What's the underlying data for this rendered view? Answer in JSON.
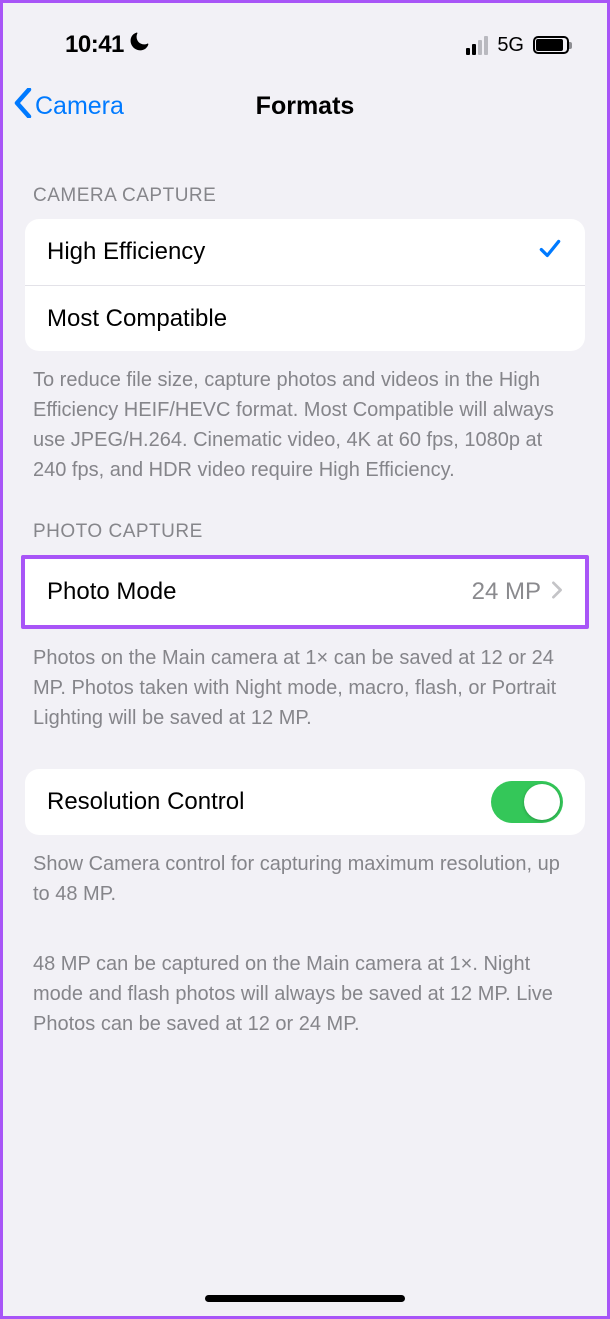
{
  "status": {
    "time": "10:41",
    "network": "5G"
  },
  "nav": {
    "back_label": "Camera",
    "title": "Formats"
  },
  "sections": {
    "camera_capture": {
      "header": "CAMERA CAPTURE",
      "options": [
        {
          "label": "High Efficiency",
          "selected": true
        },
        {
          "label": "Most Compatible",
          "selected": false
        }
      ],
      "footer": "To reduce file size, capture photos and videos in the High Efficiency HEIF/HEVC format. Most Compatible will always use JPEG/H.264. Cinematic video, 4K at 60 fps, 1080p at 240 fps, and HDR video require High Efficiency."
    },
    "photo_capture": {
      "header": "PHOTO CAPTURE",
      "photo_mode": {
        "label": "Photo Mode",
        "value": "24 MP"
      },
      "footer": "Photos on the Main camera at 1× can be saved at 12 or 24 MP. Photos taken with Night mode, macro, flash, or Portrait Lighting will be saved at 12 MP."
    },
    "resolution_control": {
      "label": "Resolution Control",
      "enabled": true,
      "footer1": "Show Camera control for capturing maximum resolution, up to 48 MP.",
      "footer2": "48 MP can be captured on the Main camera at 1×. Night mode and flash photos will always be saved at 12 MP. Live Photos can be saved at 12 or 24 MP."
    }
  }
}
